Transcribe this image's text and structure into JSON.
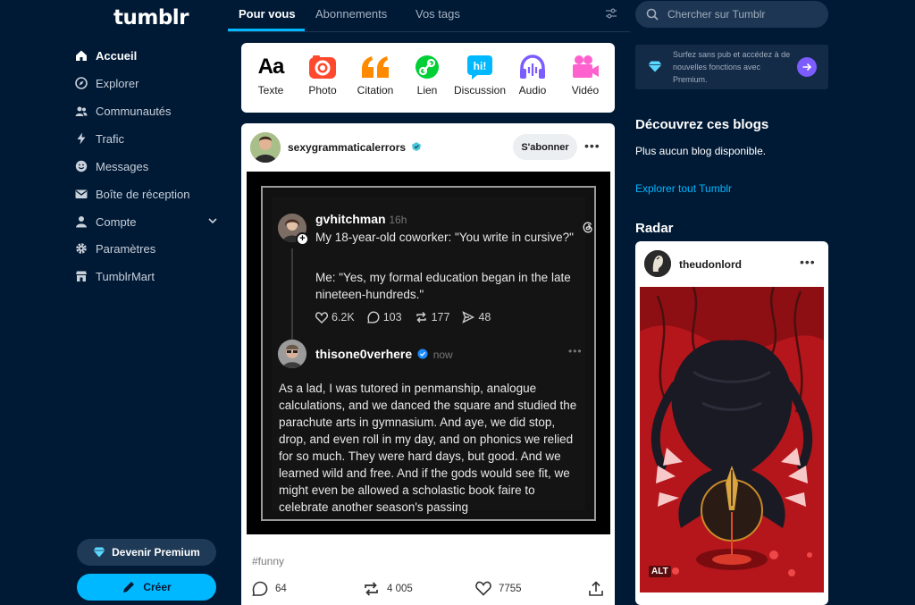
{
  "sidebar": {
    "logo": "tumblr",
    "items": [
      {
        "label": "Accueil",
        "icon": "home-icon"
      },
      {
        "label": "Explorer",
        "icon": "compass-icon"
      },
      {
        "label": "Communautés",
        "icon": "people-icon"
      },
      {
        "label": "Trafic",
        "icon": "bolt-icon"
      },
      {
        "label": "Messages",
        "icon": "smile-icon"
      },
      {
        "label": "Boîte de réception",
        "icon": "mail-icon"
      },
      {
        "label": "Compte",
        "icon": "person-icon"
      },
      {
        "label": "Paramètres",
        "icon": "gear-icon"
      },
      {
        "label": "TumblrMart",
        "icon": "shop-icon"
      }
    ],
    "premium_label": "Devenir Premium",
    "create_label": "Créer"
  },
  "tabs": [
    "Pour vous",
    "Abonnements",
    "Vos tags"
  ],
  "composer": {
    "types": [
      {
        "label": "Texte",
        "icon": "text-icon",
        "color": "#000000"
      },
      {
        "label": "Photo",
        "icon": "camera-icon",
        "color": "#ff492f"
      },
      {
        "label": "Citation",
        "icon": "quote-icon",
        "color": "#ff8a00"
      },
      {
        "label": "Lien",
        "icon": "link-icon",
        "color": "#00cf35"
      },
      {
        "label": "Discussion",
        "icon": "chat-icon",
        "color": "#00b8ff"
      },
      {
        "label": "Audio",
        "icon": "headphones-icon",
        "color": "#7c5cff"
      },
      {
        "label": "Vidéo",
        "icon": "video-icon",
        "color": "#ff62ce"
      }
    ]
  },
  "post": {
    "author": "sexygrammaticalerrors",
    "follow_label": "S'abonner",
    "thread": {
      "first_user": "gvhitchman",
      "first_time": "16h",
      "first_line1": "My 18-year-old coworker: \"You write in cursive?\"",
      "first_line2": "Me: \"Yes, my formal education began in the late nineteen-hundreds.\"",
      "likes": "6.2K",
      "replies": "103",
      "reposts": "177",
      "shares": "48",
      "second_user": "thisone0verhere",
      "second_time": "now",
      "second_text": "As a lad, I was tutored in penmanship, analogue calculations, and we danced the square and studied the parachute arts in gymnasium. And aye, we did stop, drop, and even roll in my day, and on phonics we relied for so much. They were hard days, but good. And we learned wild and free. And if the gods would see fit, we might even be allowed a scholastic book faire to celebrate another season's passing"
    },
    "tag": "#funny",
    "comments": "64",
    "reblogs": "4 005",
    "likes": "7755"
  },
  "right": {
    "search_placeholder": "Chercher sur Tumblr",
    "ad_text": "Surfez sans pub et accédez à de nouvelles fonctions avec Premium.",
    "discover_title": "Découvrez ces blogs",
    "no_blog": "Plus aucun blog disponible.",
    "explore_link": "Explorer tout Tumblr",
    "radar_title": "Radar",
    "radar_author": "theudonlord",
    "alt_label": "ALT"
  }
}
